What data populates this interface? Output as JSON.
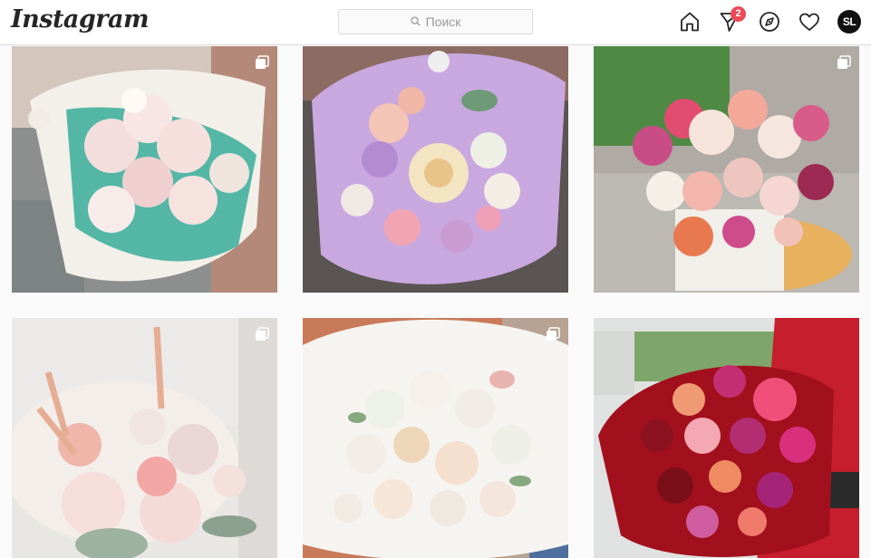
{
  "app": {
    "logo_text": "Instagram"
  },
  "search": {
    "placeholder": "Поиск"
  },
  "nav": {
    "activity_badge": "2",
    "avatar_initials": "SL"
  },
  "icons": [
    "search-icon",
    "home-icon",
    "direct-icon",
    "explore-icon",
    "heart-icon",
    "multi-photo-icon"
  ],
  "posts": [
    {
      "subject": "white-pink ranunculus bouquet in mint paper",
      "multi": true
    },
    {
      "subject": "pastel peony rose bouquet in lilac paper",
      "multi": false
    },
    {
      "subject": "pink rose box arrangement",
      "multi": true
    },
    {
      "subject": "bridal pastel bouquet with astilbe",
      "multi": true
    },
    {
      "subject": "white spray rose bouquet in white paper",
      "multi": true
    },
    {
      "subject": "red and pink bouquet in red paper",
      "multi": false
    }
  ],
  "colors": {
    "badge": "#ed4956",
    "border": "#dbdbdb",
    "background": "#fafafa"
  }
}
